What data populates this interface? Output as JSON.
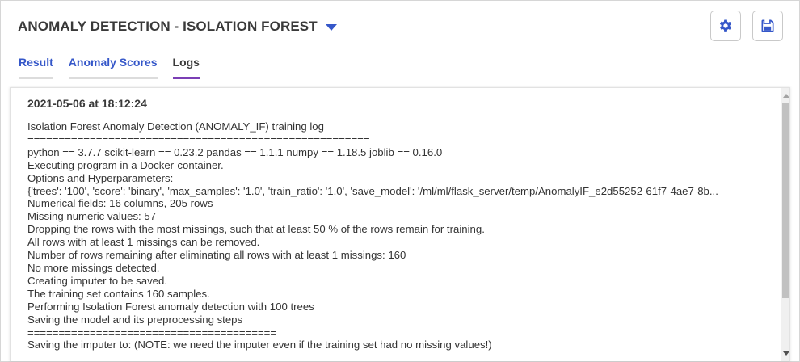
{
  "header": {
    "title": "ANOMALY DETECTION - ISOLATION FOREST",
    "accent_color": "#3557c9"
  },
  "toolbar": {
    "settings_icon": "gear-icon",
    "save_icon": "floppy-disk-icon"
  },
  "tabs": [
    {
      "label": "Result",
      "active": false
    },
    {
      "label": "Anomaly Scores",
      "active": false
    },
    {
      "label": "Logs",
      "active": true
    }
  ],
  "log": {
    "timestamp": "2021-05-06 at 18:12:24",
    "lines": [
      "Isolation Forest Anomaly Detection (ANOMALY_IF) training log",
      "=======================================================",
      "python == 3.7.7  scikit-learn == 0.23.2  pandas == 1.1.1  numpy == 1.18.5  joblib == 0.16.0",
      "Executing program in a Docker-container.",
      "Options and Hyperparameters:",
      " {'trees': '100', 'score': 'binary', 'max_samples': '1.0', 'train_ratio': '1.0', 'save_model': '/ml/ml/flask_server/temp/AnomalyIF_e2d55252-61f7-4ae7-8b...",
      "Numerical fields:  16 columns,  205 rows",
      "Missing numeric values:  57",
      "Dropping the rows with the most missings, such that at least 50 % of the rows remain for training.",
      "All rows with at least 1 missings can be removed.",
      "Number of rows remaining after eliminating all rows with at least 1 missings:  160",
      "No more missings detected.",
      "Creating imputer to be saved.",
      "The training set contains 160 samples.",
      "Performing Isolation Forest anomaly detection with 100 trees",
      "Saving the model and its preprocessing steps",
      "========================================",
      "Saving the imputer to: (NOTE: we need the imputer even if the training set had no missing values!)"
    ]
  }
}
